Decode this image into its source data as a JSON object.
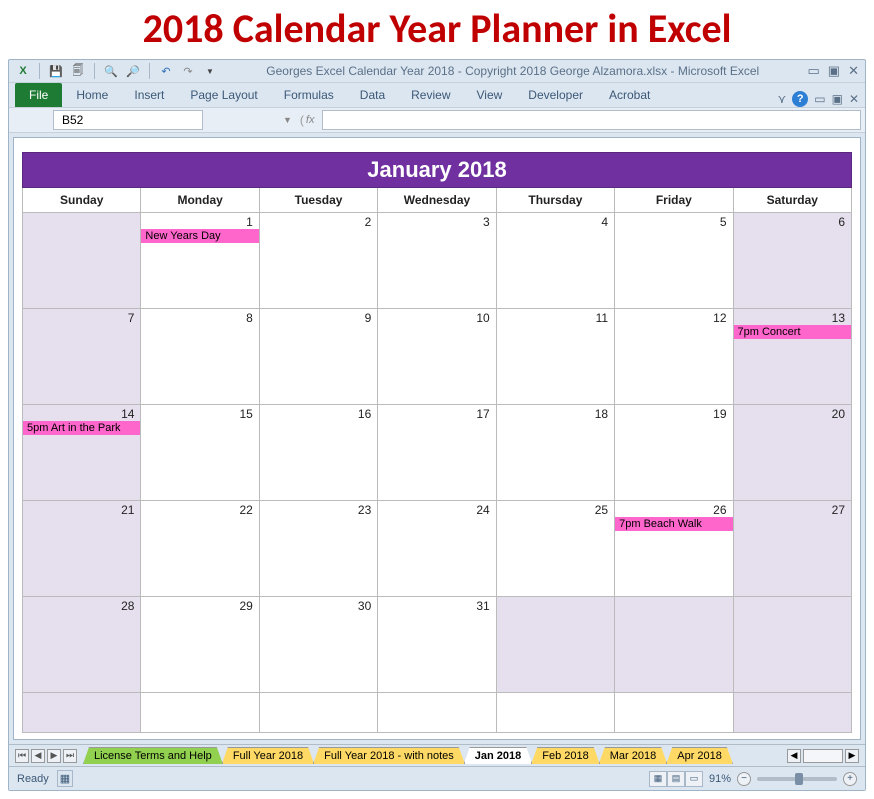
{
  "page_heading": "2018 Calendar Year Planner in Excel",
  "qat": {
    "doc_title": "Georges Excel Calendar Year 2018  -  Copyright 2018 George Alzamora.xlsx  -  Microsoft Excel"
  },
  "ribbon": {
    "file": "File",
    "tabs": [
      "Home",
      "Insert",
      "Page Layout",
      "Formulas",
      "Data",
      "Review",
      "View",
      "Developer",
      "Acrobat"
    ]
  },
  "formula_bar": {
    "cell_ref": "B52",
    "fx_label": "fx",
    "value": ""
  },
  "calendar": {
    "title": "January 2018",
    "headers": [
      "Sunday",
      "Monday",
      "Tuesday",
      "Wednesday",
      "Thursday",
      "Friday",
      "Saturday"
    ],
    "weeks": [
      [
        {
          "day": "",
          "blank": true
        },
        {
          "day": "1",
          "event": "New Years Day"
        },
        {
          "day": "2"
        },
        {
          "day": "3"
        },
        {
          "day": "4"
        },
        {
          "day": "5"
        },
        {
          "day": "6",
          "shaded": true
        }
      ],
      [
        {
          "day": "7",
          "shaded": true
        },
        {
          "day": "8"
        },
        {
          "day": "9"
        },
        {
          "day": "10"
        },
        {
          "day": "11"
        },
        {
          "day": "12"
        },
        {
          "day": "13",
          "shaded": true,
          "event": "7pm Concert"
        }
      ],
      [
        {
          "day": "14",
          "shaded": true,
          "event": "5pm Art in the Park"
        },
        {
          "day": "15"
        },
        {
          "day": "16"
        },
        {
          "day": "17"
        },
        {
          "day": "18"
        },
        {
          "day": "19"
        },
        {
          "day": "20",
          "shaded": true
        }
      ],
      [
        {
          "day": "21",
          "shaded": true
        },
        {
          "day": "22"
        },
        {
          "day": "23"
        },
        {
          "day": "24"
        },
        {
          "day": "25"
        },
        {
          "day": "26",
          "event": "7pm Beach Walk"
        },
        {
          "day": "27",
          "shaded": true
        }
      ],
      [
        {
          "day": "28",
          "shaded": true
        },
        {
          "day": "29"
        },
        {
          "day": "30"
        },
        {
          "day": "31"
        },
        {
          "day": "",
          "blank": true
        },
        {
          "day": "",
          "blank": true
        },
        {
          "day": "",
          "blank": true
        }
      ]
    ]
  },
  "sheet_tabs": [
    {
      "label": "License Terms and Help",
      "color": "green"
    },
    {
      "label": "Full Year 2018",
      "color": "yellow"
    },
    {
      "label": "Full Year 2018 - with notes",
      "color": "yellow"
    },
    {
      "label": "Jan 2018",
      "color": "white",
      "active": true
    },
    {
      "label": "Feb 2018",
      "color": "yellow"
    },
    {
      "label": "Mar 2018",
      "color": "yellow"
    },
    {
      "label": "Apr 2018",
      "color": "yellow"
    }
  ],
  "status": {
    "ready": "Ready",
    "zoom": "91%"
  }
}
